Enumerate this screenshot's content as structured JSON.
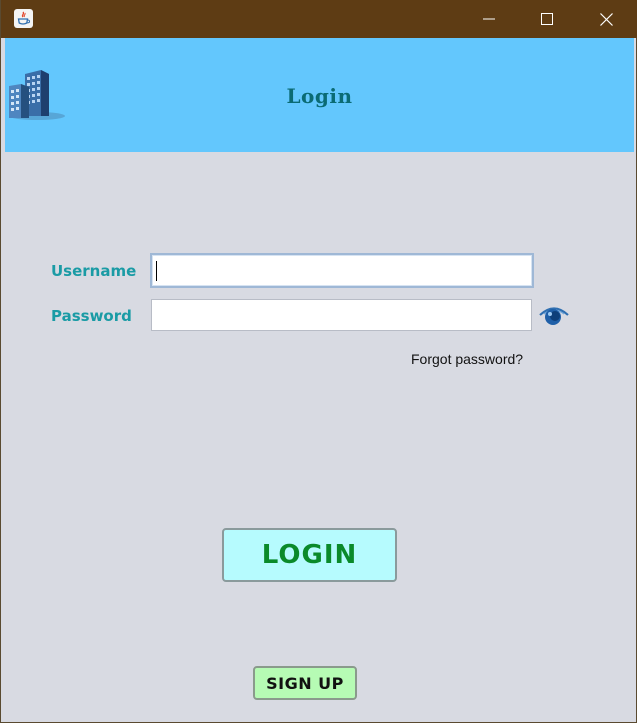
{
  "window": {
    "title": "",
    "colors": {
      "titlebar": "#5e3c14",
      "header": "#63c7fd",
      "body": "#d8dae2"
    }
  },
  "header": {
    "title": "Login",
    "logo_icon": "building-icon"
  },
  "form": {
    "username_label": "Username",
    "username_value": "",
    "password_label": "Password",
    "password_value": "",
    "show_password_icon": "eye-icon",
    "forgot_password_link": "Forgot password?"
  },
  "actions": {
    "login_label": "LOGIN",
    "signup_label": "SIGN UP"
  }
}
